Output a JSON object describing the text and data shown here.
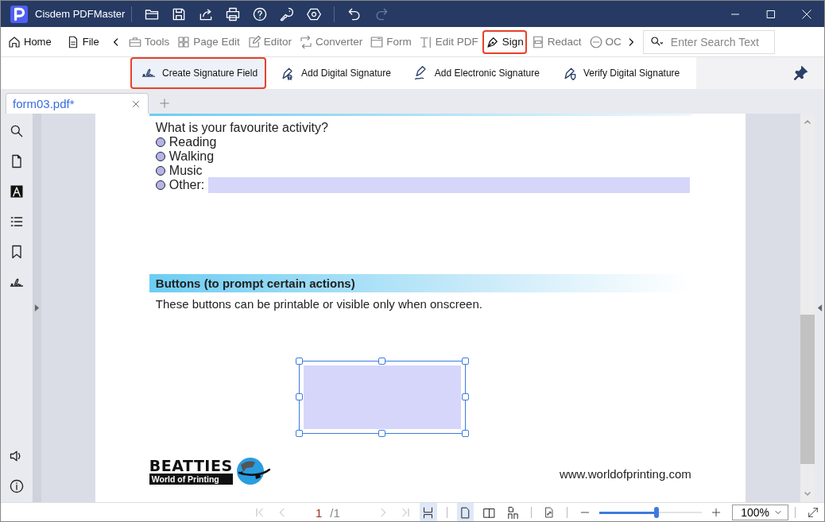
{
  "window": {
    "app_title": "Cisdem PDFMaster"
  },
  "menus": [
    {
      "label": "Home"
    },
    {
      "label": "File"
    }
  ],
  "toolbar": {
    "tools": [
      {
        "label": "Tools",
        "selected": false
      },
      {
        "label": "Page Edit",
        "selected": false
      },
      {
        "label": "Editor",
        "selected": false
      },
      {
        "label": "Converter",
        "selected": false
      },
      {
        "label": "Form",
        "selected": false
      },
      {
        "label": "Edit PDF",
        "selected": false
      },
      {
        "label": "Sign",
        "selected": true
      },
      {
        "label": "Redact",
        "selected": false
      },
      {
        "label": "OC",
        "selected": false
      }
    ],
    "search": {
      "placeholder": "Enter Search Text"
    }
  },
  "sign_tools": [
    {
      "label": "Create Signature Field",
      "selected": true
    },
    {
      "label": "Add Digital Signature",
      "selected": false
    },
    {
      "label": "Add Electronic Signature",
      "selected": false
    },
    {
      "label": "Verify Digital Signature",
      "selected": false
    }
  ],
  "tabs": [
    {
      "label": "form03.pdf*"
    }
  ],
  "document": {
    "question": "What is your favourite activity?",
    "options": [
      {
        "label": "Reading",
        "checked": false,
        "kind": "plain"
      },
      {
        "label": "Walking",
        "checked": false,
        "kind": "plain"
      },
      {
        "label": "Music",
        "checked": false,
        "kind": "plain"
      },
      {
        "label": "Other:",
        "checked": false,
        "kind": "text"
      }
    ],
    "heading": "Buttons (to prompt certain actions)",
    "paragraph": "These buttons can be printable or visible only when onscreen.",
    "signature_field": {
      "selected": true
    },
    "logo": {
      "title": "BEATTIES",
      "subtitle": "World of Printing"
    },
    "url": "www.worldofprinting.com"
  },
  "nav": {
    "page": "1",
    "total": "/1"
  },
  "view_modes": [
    {
      "selected": true
    },
    {
      "selected": true
    },
    {
      "selected": false
    },
    {
      "selected": false
    }
  ],
  "zoom": {
    "level": 0.56,
    "value": "100%"
  }
}
